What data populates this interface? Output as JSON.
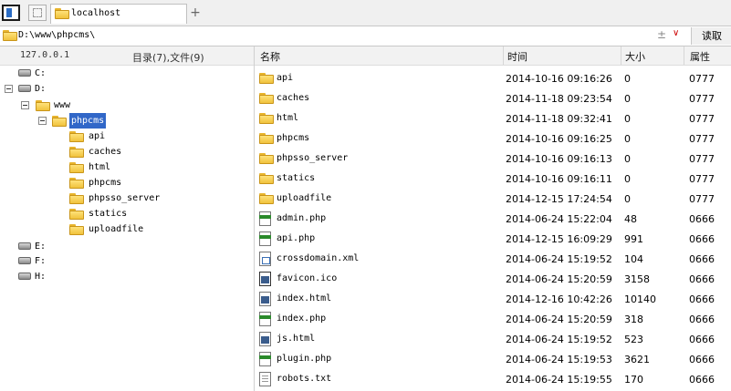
{
  "tabs": {
    "active_label": "localhost",
    "add_label": "+"
  },
  "address": {
    "path": "D:\\www\\phpcms\\",
    "plusminus": "±",
    "dropdown": "∨",
    "read_button": "读取"
  },
  "left_panel": {
    "host": "127.0.0.1",
    "summary": "目录(7),文件(9)",
    "tree": {
      "drive_c": "C:",
      "drive_d": "D:",
      "www": "www",
      "phpcms": "phpcms",
      "children": [
        "api",
        "caches",
        "html",
        "phpcms",
        "phpsso_server",
        "statics",
        "uploadfile"
      ],
      "drive_e": "E:",
      "drive_f": "F:",
      "drive_h": "H:"
    }
  },
  "columns": {
    "name": "名称",
    "time": "时间",
    "size": "大小",
    "attr": "属性"
  },
  "files": [
    {
      "name": "api",
      "time": "2014-10-16 09:16:26",
      "size": "0",
      "attr": "0777",
      "icon": "folder-icon"
    },
    {
      "name": "caches",
      "time": "2014-11-18 09:23:54",
      "size": "0",
      "attr": "0777",
      "icon": "folder-icon"
    },
    {
      "name": "html",
      "time": "2014-11-18 09:32:41",
      "size": "0",
      "attr": "0777",
      "icon": "folder-icon"
    },
    {
      "name": "phpcms",
      "time": "2014-10-16 09:16:25",
      "size": "0",
      "attr": "0777",
      "icon": "folder-icon"
    },
    {
      "name": "phpsso_server",
      "time": "2014-10-16 09:16:13",
      "size": "0",
      "attr": "0777",
      "icon": "folder-icon"
    },
    {
      "name": "statics",
      "time": "2014-10-16 09:16:11",
      "size": "0",
      "attr": "0777",
      "icon": "folder-icon"
    },
    {
      "name": "uploadfile",
      "time": "2014-12-15 17:24:54",
      "size": "0",
      "attr": "0777",
      "icon": "folder-icon"
    },
    {
      "name": "admin.php",
      "time": "2014-06-24 15:22:04",
      "size": "48",
      "attr": "0666",
      "icon": "php-file-icon"
    },
    {
      "name": "api.php",
      "time": "2014-12-15 16:09:29",
      "size": "991",
      "attr": "0666",
      "icon": "php-file-icon"
    },
    {
      "name": "crossdomain.xml",
      "time": "2014-06-24 15:19:52",
      "size": "104",
      "attr": "0666",
      "icon": "xml-file-icon"
    },
    {
      "name": "favicon.ico",
      "time": "2014-06-24 15:20:59",
      "size": "3158",
      "attr": "0666",
      "icon": "ico-file-icon"
    },
    {
      "name": "index.html",
      "time": "2014-12-16 10:42:26",
      "size": "10140",
      "attr": "0666",
      "icon": "html-file-icon"
    },
    {
      "name": "index.php",
      "time": "2014-06-24 15:20:59",
      "size": "318",
      "attr": "0666",
      "icon": "php-file-icon"
    },
    {
      "name": "js.html",
      "time": "2014-06-24 15:19:52",
      "size": "523",
      "attr": "0666",
      "icon": "html-file-icon"
    },
    {
      "name": "plugin.php",
      "time": "2014-06-24 15:19:53",
      "size": "3621",
      "attr": "0666",
      "icon": "php-file-icon"
    },
    {
      "name": "robots.txt",
      "time": "2014-06-24 15:19:55",
      "size": "170",
      "attr": "0666",
      "icon": "txt-file-icon"
    }
  ]
}
